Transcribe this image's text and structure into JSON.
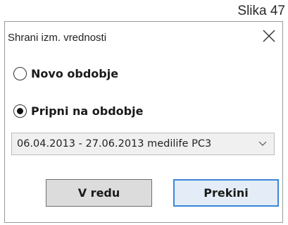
{
  "caption": "Slika 47",
  "dialog": {
    "title": "Shrani izm. vrednosti",
    "close_icon": "close-icon",
    "options": [
      {
        "label": "Novo obdobje",
        "selected": false
      },
      {
        "label": "Pripni na obdobje",
        "selected": true
      }
    ],
    "period_select": {
      "value": "06.04.2013 - 27.06.2013 medilife PC3",
      "icon": "chevron-down-icon"
    },
    "buttons": {
      "ok_label": "V redu",
      "cancel_label": "Prekini"
    },
    "colors": {
      "focus_border": "#3b86d8",
      "focus_fill": "#e4edf7"
    }
  }
}
